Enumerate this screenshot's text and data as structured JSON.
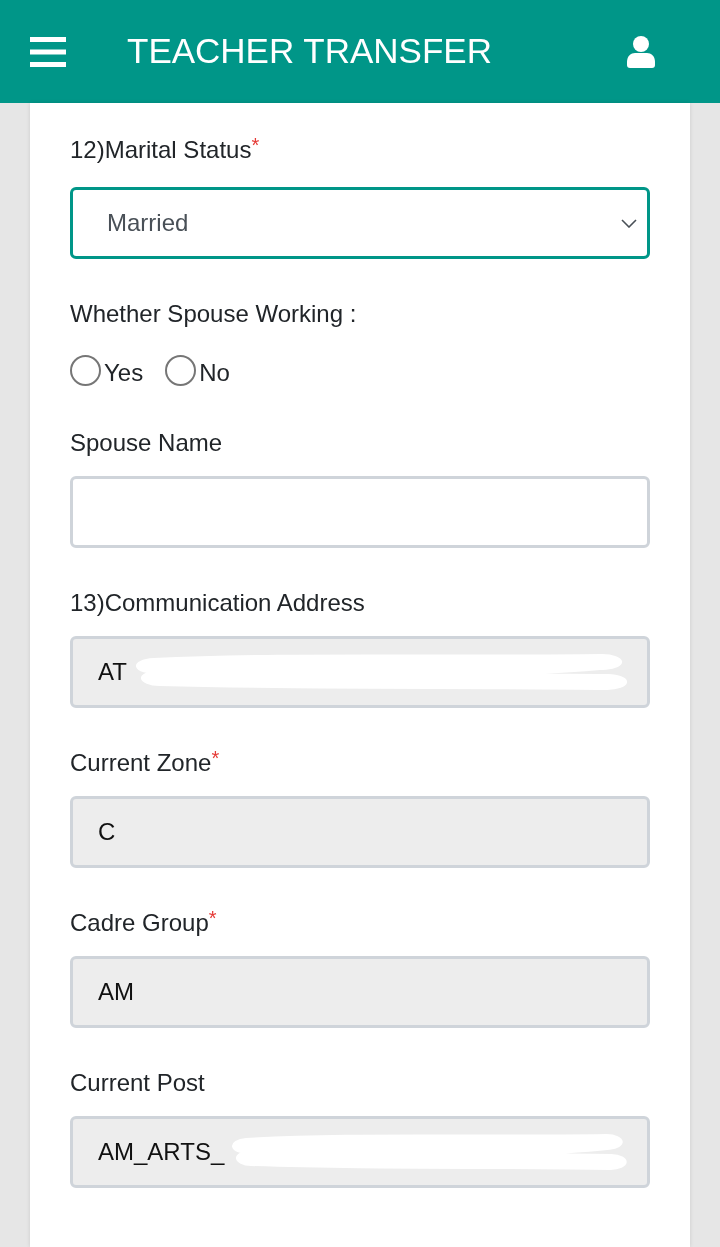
{
  "header": {
    "title": "TEACHER TRANSFER"
  },
  "fields": [
    {
      "kind": "select",
      "label": "12)Marital Status",
      "required_mark": "*",
      "value": "Married",
      "focused": true
    },
    {
      "kind": "radio",
      "label": "Whether Spouse Working :",
      "options": [
        {
          "label": "Yes",
          "selected": false
        },
        {
          "label": "No",
          "selected": false
        }
      ]
    },
    {
      "kind": "text",
      "label": "Spouse Name",
      "readonly": false
    },
    {
      "kind": "text",
      "label": "13)Communication Address",
      "value": "AT",
      "readonly": true,
      "redacted": true
    },
    {
      "kind": "text",
      "label": "Current Zone",
      "required_mark": "*",
      "value": "C",
      "readonly": true
    },
    {
      "kind": "text",
      "label": "Cadre Group",
      "required_mark": "*",
      "value": "AM",
      "readonly": true
    },
    {
      "kind": "text",
      "label": "Current Post",
      "value": "AM_ARTS_",
      "readonly": true,
      "redacted": true
    }
  ]
}
